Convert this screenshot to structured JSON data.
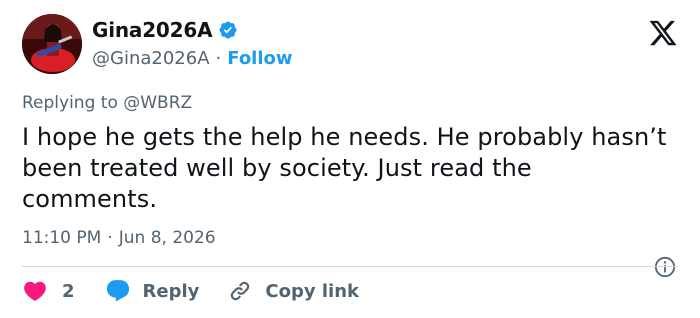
{
  "user": {
    "display_name": "Gina2026A",
    "handle": "@Gina2026A",
    "separator": "·",
    "follow_label": "Follow"
  },
  "reply_context": {
    "prefix": "Replying to ",
    "mention": "@WBRZ"
  },
  "tweet": {
    "text": "I hope he gets the help he needs. He probably hasn’t been treated well by society. Just read the comments.",
    "time": "11:10 PM",
    "separator": "·",
    "date": "Jun 8, 2026"
  },
  "actions": {
    "like_count": "2",
    "reply_label": "Reply",
    "copy_label": "Copy link"
  },
  "icons": {
    "verified": "verified-badge-icon",
    "logo": "x-logo-icon",
    "info": "info-icon",
    "like": "heart-icon",
    "reply": "speech-bubble-icon",
    "copy": "link-icon"
  },
  "colors": {
    "accent": "#1d9bf0",
    "like": "#f91880",
    "muted": "#536471",
    "text": "#0f1419"
  }
}
